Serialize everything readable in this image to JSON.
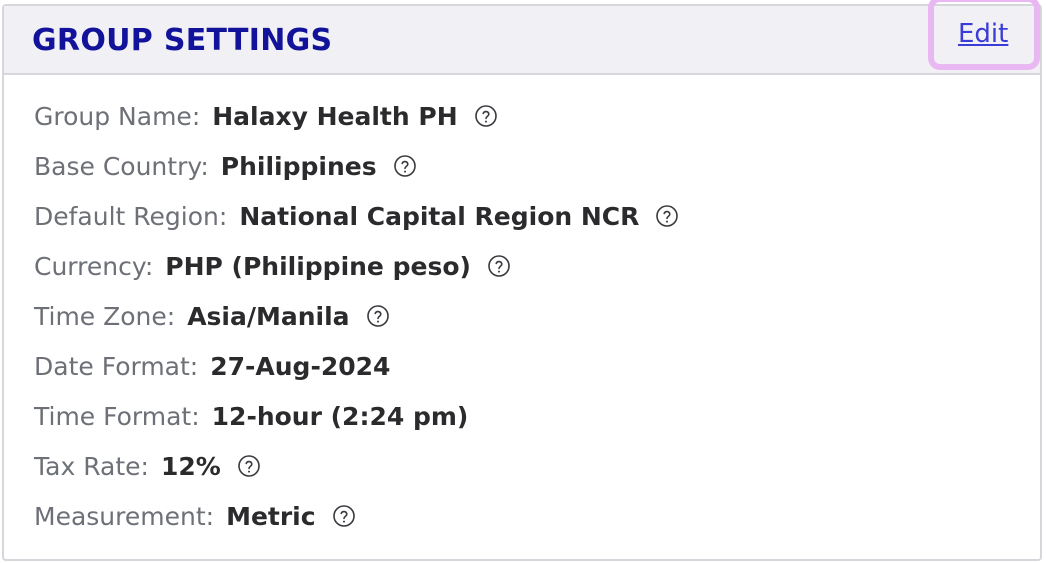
{
  "panel": {
    "title": "GROUP SETTINGS",
    "edit_label": "Edit"
  },
  "settings": [
    {
      "label": "Group Name:",
      "value": "Halaxy Health PH",
      "help": true
    },
    {
      "label": "Base Country:",
      "value": "Philippines",
      "help": true
    },
    {
      "label": "Default Region:",
      "value": "National Capital Region NCR",
      "help": true
    },
    {
      "label": "Currency:",
      "value": "PHP (Philippine peso)",
      "help": true
    },
    {
      "label": "Time Zone:",
      "value": "Asia/Manila",
      "help": true
    },
    {
      "label": "Date Format:",
      "value": "27-Aug-2024",
      "help": false
    },
    {
      "label": "Time Format:",
      "value": "12-hour (2:24 pm)",
      "help": false
    },
    {
      "label": "Tax Rate:",
      "value": "12%",
      "help": true
    },
    {
      "label": "Measurement:",
      "value": "Metric",
      "help": true
    }
  ],
  "colors": {
    "title": "#12129a",
    "link": "#3b3bd6",
    "focus_ring": "#e9b8f3",
    "header_bg": "#f0f0f5"
  },
  "icons": {
    "help": "question-circle-icon"
  }
}
